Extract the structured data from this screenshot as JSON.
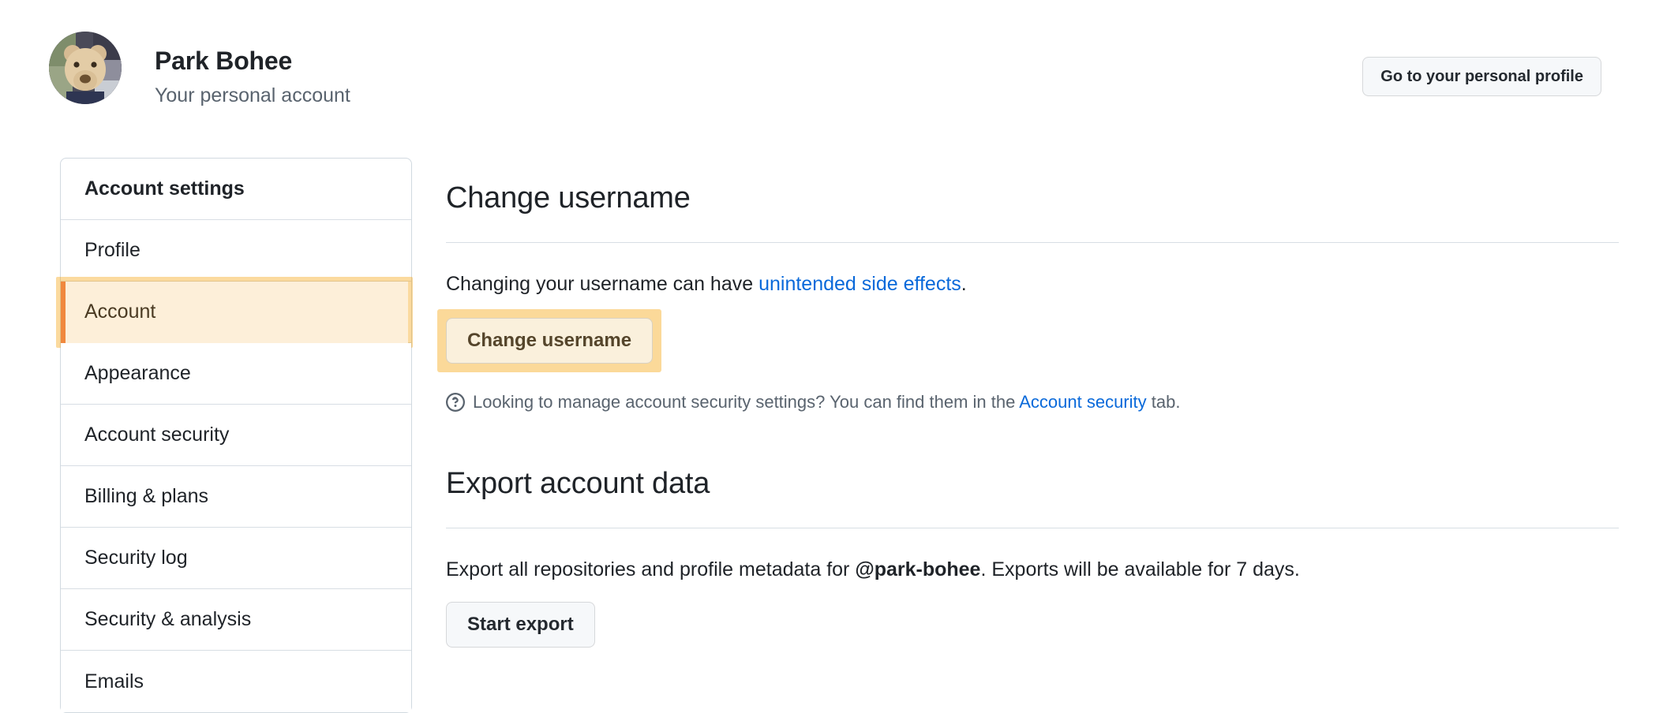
{
  "header": {
    "name": "Park Bohee",
    "subtitle": "Your personal account",
    "profile_button": "Go to your personal profile",
    "avatar_alt": "teddy-bear-photo"
  },
  "sidebar": {
    "heading": "Account settings",
    "items": [
      {
        "label": "Profile",
        "highlighted": false
      },
      {
        "label": "Account",
        "highlighted": true
      },
      {
        "label": "Appearance",
        "highlighted": false
      },
      {
        "label": "Account security",
        "highlighted": false
      },
      {
        "label": "Billing & plans",
        "highlighted": false
      },
      {
        "label": "Security log",
        "highlighted": false
      },
      {
        "label": "Security & analysis",
        "highlighted": false
      },
      {
        "label": "Emails",
        "highlighted": false
      }
    ]
  },
  "main": {
    "change_username": {
      "title": "Change username",
      "description_prefix": "Changing your username can have ",
      "description_link": "unintended side effects",
      "description_suffix": ".",
      "button_label": "Change username",
      "note_prefix": "Looking to manage account security settings? You can find them in the ",
      "note_link": "Account security",
      "note_suffix": " tab.",
      "note_icon": "question-circle-icon"
    },
    "export": {
      "title": "Export account data",
      "description_prefix": "Export all repositories and profile metadata for ",
      "username": "@park-bohee",
      "description_suffix": ". Exports will be available for 7 days.",
      "button_label": "Start export"
    }
  },
  "colors": {
    "highlight_ring": "#f59f00",
    "highlight_fill": "#fdefd9",
    "highlight_bar": "#f0883e",
    "link": "#0969da",
    "muted_text": "#59636e",
    "border": "#d8dee4"
  }
}
